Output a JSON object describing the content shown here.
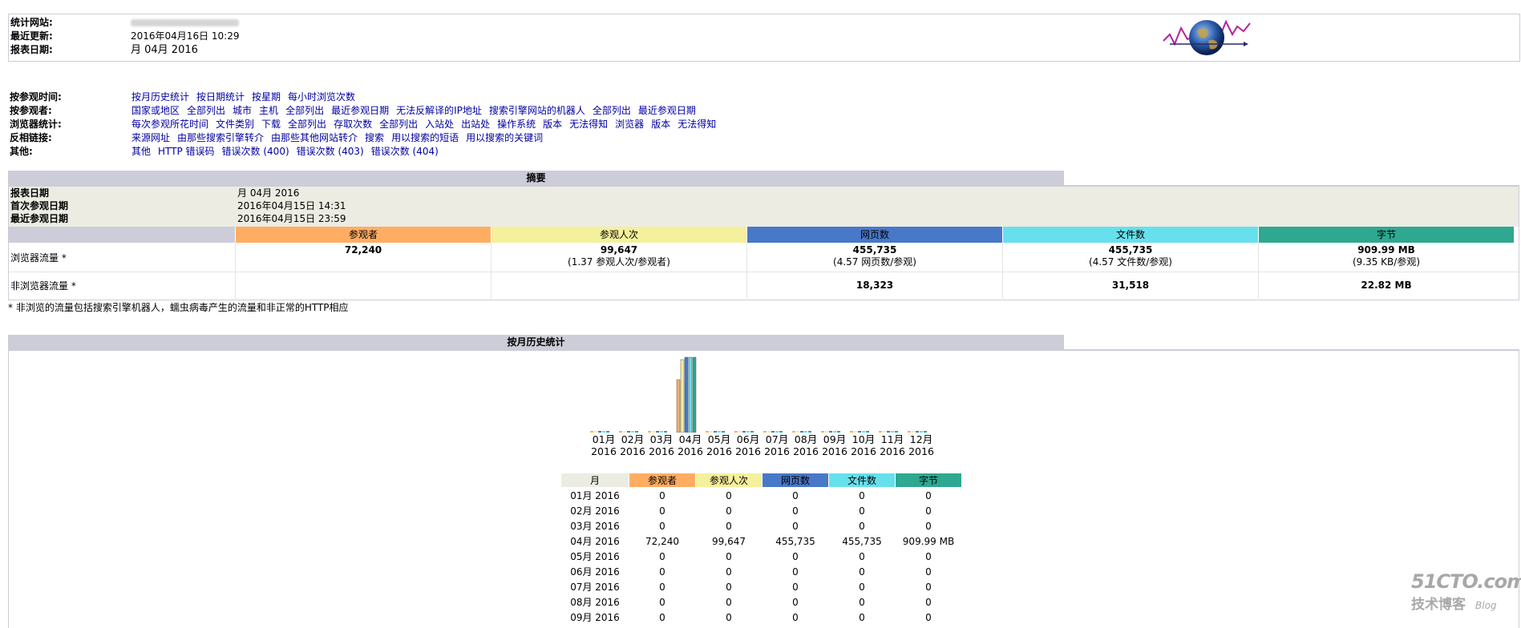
{
  "header": {
    "site_label": "统计网站:",
    "updated_label": "最近更新:",
    "updated_value": "2016年04月16日 10:29",
    "period_label": "报表日期:",
    "period_value": "月 04月 2016"
  },
  "nav": [
    {
      "label": "按参观时间:",
      "links": [
        "按月历史统计",
        "按日期统计",
        "按星期",
        "每小时浏览次数"
      ]
    },
    {
      "label": "按参观者:",
      "links": [
        "国家或地区",
        "全部列出",
        "城市",
        "主机",
        "全部列出",
        "最近参观日期",
        "无法反解译的IP地址",
        "搜索引擎网站的机器人",
        "全部列出",
        "最近参观日期"
      ]
    },
    {
      "label": "浏览器统计:",
      "links": [
        "每次参观所花时间",
        "文件类别",
        "下载",
        "全部列出",
        "存取次数",
        "全部列出",
        "入站处",
        "出站处",
        "操作系统",
        "版本",
        "无法得知",
        "浏览器",
        "版本",
        "无法得知"
      ]
    },
    {
      "label": "反相链接:",
      "links": [
        "来源网址",
        "由那些搜索引擎转介",
        "由那些其他网站转介",
        "搜索",
        "用以搜索的短语",
        "用以搜索的关键词"
      ]
    },
    {
      "label": "其他:",
      "links": [
        "其他",
        "HTTP 错误码",
        "错误次数 (400)",
        "错误次数 (403)",
        "错误次数 (404)"
      ]
    }
  ],
  "summary": {
    "title": "摘要",
    "report_label": "报表日期",
    "report_value": "月 04月 2016",
    "first_label": "首次参观日期",
    "first_value": "2016年04月15日 14:31",
    "last_label": "最近参观日期",
    "last_value": "2016年04月15日 23:59",
    "columns": [
      "参观者",
      "参观人次",
      "网页数",
      "文件数",
      "字节"
    ],
    "colors": [
      "#ffad62",
      "#f4f09c",
      "#4878c8",
      "#66e0ec",
      "#2ea890"
    ],
    "browser_label": "浏览器流量 *",
    "browser_values": [
      "72,240",
      "99,647",
      "455,735",
      "455,735",
      "909.99 MB"
    ],
    "browser_subs": [
      "",
      "(1.37 参观人次/参观者)",
      "(4.57 网页数/参观)",
      "(4.57 文件数/参观)",
      "(9.35 KB/参观)"
    ],
    "nonbrowser_label": "非浏览器流量 *",
    "nonbrowser_values": [
      "",
      "",
      "18,323",
      "31,518",
      "22.82 MB"
    ],
    "footnote": "* 非浏览的流量包括搜索引擎机器人，蠕虫病毒产生的流量和非正常的HTTP相应"
  },
  "monthly": {
    "title": "按月历史统计",
    "month_header": "月",
    "month_header_color": "#ecece3",
    "columns": [
      "参观者",
      "参观人次",
      "网页数",
      "文件数",
      "字节"
    ],
    "months": [
      "01月",
      "02月",
      "03月",
      "04月",
      "05月",
      "06月",
      "07月",
      "08月",
      "09月",
      "10月",
      "11月",
      "12月"
    ],
    "year": "2016",
    "rows": [
      [
        "01月 2016",
        "0",
        "0",
        "0",
        "0",
        "0"
      ],
      [
        "02月 2016",
        "0",
        "0",
        "0",
        "0",
        "0"
      ],
      [
        "03月 2016",
        "0",
        "0",
        "0",
        "0",
        "0"
      ],
      [
        "04月 2016",
        "72,240",
        "99,647",
        "455,735",
        "455,735",
        "909.99 MB"
      ],
      [
        "05月 2016",
        "0",
        "0",
        "0",
        "0",
        "0"
      ],
      [
        "06月 2016",
        "0",
        "0",
        "0",
        "0",
        "0"
      ],
      [
        "07月 2016",
        "0",
        "0",
        "0",
        "0",
        "0"
      ],
      [
        "08月 2016",
        "0",
        "0",
        "0",
        "0",
        "0"
      ],
      [
        "09月 2016",
        "0",
        "0",
        "0",
        "0",
        "0"
      ]
    ]
  },
  "chart_data": {
    "type": "bar",
    "categories": [
      "01月 2016",
      "02月 2016",
      "03月 2016",
      "04月 2016",
      "05月 2016",
      "06月 2016",
      "07月 2016",
      "08月 2016",
      "09月 2016",
      "10月 2016",
      "11月 2016",
      "12月 2016"
    ],
    "series": [
      {
        "name": "参观者",
        "color": "#ffad62",
        "values": [
          0,
          0,
          0,
          72240,
          0,
          0,
          0,
          0,
          0,
          0,
          0,
          0
        ]
      },
      {
        "name": "参观人次",
        "color": "#f4f09c",
        "values": [
          0,
          0,
          0,
          99647,
          0,
          0,
          0,
          0,
          0,
          0,
          0,
          0
        ]
      },
      {
        "name": "网页数",
        "color": "#4878c8",
        "values": [
          0,
          0,
          0,
          455735,
          0,
          0,
          0,
          0,
          0,
          0,
          0,
          0
        ]
      },
      {
        "name": "文件数",
        "color": "#66e0ec",
        "values": [
          0,
          0,
          0,
          455735,
          0,
          0,
          0,
          0,
          0,
          0,
          0,
          0
        ]
      },
      {
        "name": "字节",
        "color": "#2ea890",
        "values": [
          0,
          0,
          0,
          909.99,
          0,
          0,
          0,
          0,
          0,
          0,
          0,
          0
        ]
      }
    ]
  },
  "watermark": {
    "brand": "51CTO.com",
    "sub": "技术博客",
    "blog": "Blog"
  }
}
